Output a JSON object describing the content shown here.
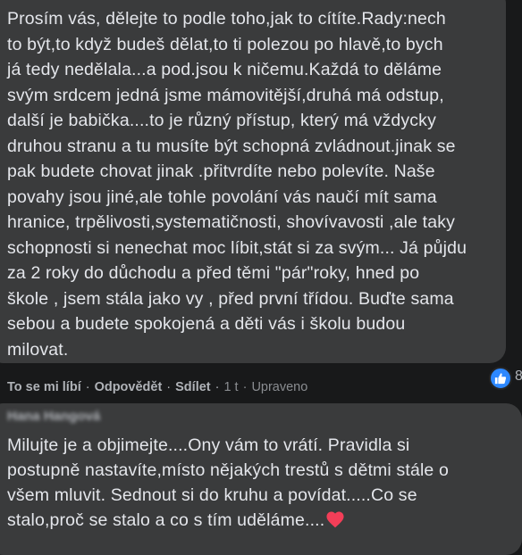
{
  "comment": {
    "text": "Prosím vás, dělejte to podle toho,jak to cítíte.Rady:nech\nto být,to když budeš dělat,to ti polezou po hlavě,to bych\njá tedy nedělala...a pod.jsou k ničemu.Každá to děláme\nsvým srdcem jedná jsme mámovitější,druhá má odstup,\ndalší je babička....to je různý přístup, který má vždycky\ndruhou stranu a tu musíte být schopná zvládnout.jinak se\npak budete chovat jinak .přitvrdíte nebo polevíte. Naše\npovahy jsou jiné,ale tohle povolání vás naučí mít sama\nhranice, trpělivosti,systematičnosti, shovívavosti ,ale taky\nschopnosti si nenechat moc líbit,stát si za svým... Já půjdu\nza 2 roky do důchodu a před těmi \"pár\"roky, hned po\nškole , jsem stála jako vy , před první třídou. Buďte sama\nsebou a budete spokojená a děti vás i školu budou\nmilovat.",
    "reaction_count": "8",
    "reaction_icon": "like-icon",
    "actions": {
      "like": "To se mi líbí",
      "reply": "Odpovědět",
      "share": "Sdílet",
      "time": "1 t",
      "edited": "Upraveno",
      "separator": "·"
    }
  },
  "reply": {
    "author": "Hana Hangová",
    "text": "Milujte je a objimejte....Ony vám to vrátí. Pravidla si\npostupně nastavíte,místo nějakých trestů s dětmi stále o\nvšem mluvit. Sednout si do kruhu a povídat.....Co se\nstalo,proč se stalo a co s tím uděláme....",
    "trailing_icon": "heart-icon"
  },
  "colors": {
    "background": "#18191a",
    "bubble": "#3a3b3c",
    "text": "#e4e6eb",
    "secondary_text": "#b0b3b8",
    "like_blue": "#2d88ff",
    "heart_red": "#f33e58"
  }
}
